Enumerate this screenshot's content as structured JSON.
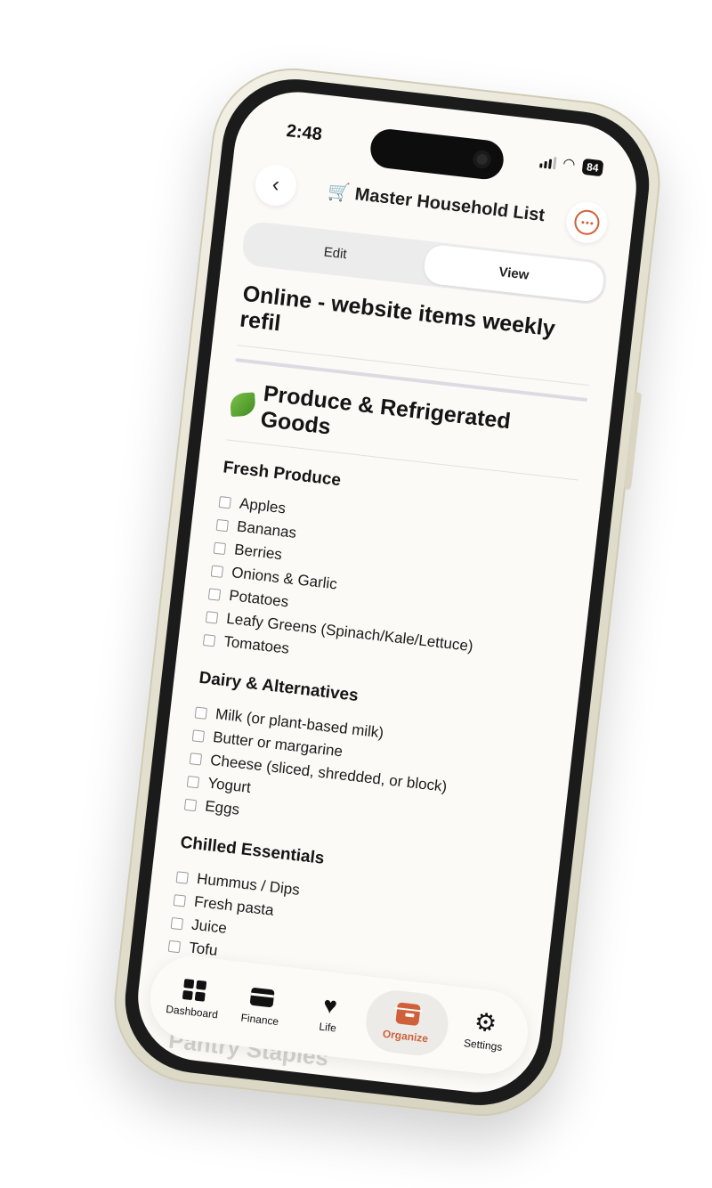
{
  "status": {
    "time": "2:48",
    "battery": "84"
  },
  "header": {
    "title": "🛒 Master Household  List"
  },
  "segments": {
    "edit": "Edit",
    "view": "View"
  },
  "document": {
    "heading": "Online - website items weekly refil",
    "section_title": "Produce & Refrigerated Goods",
    "groups": [
      {
        "title": "Fresh Produce",
        "items": [
          "Apples",
          "Bananas",
          "Berries",
          "Onions & Garlic",
          "Potatoes",
          "Leafy Greens (Spinach/Kale/Lettuce)",
          "Tomatoes"
        ]
      },
      {
        "title": "Dairy & Alternatives",
        "items": [
          "Milk (or plant-based milk)",
          "Butter or margarine",
          "Cheese (sliced, shredded, or block)",
          "Yogurt",
          "Eggs"
        ]
      },
      {
        "title": "Chilled Essentials",
        "items": [
          "Hummus / Dips",
          "Fresh pasta",
          "Juice",
          "Tofu"
        ]
      }
    ],
    "next_section_peek": "Pantry Staples"
  },
  "tabbar": {
    "dashboard": "Dashboard",
    "finance": "Finance",
    "life": "Life",
    "organize": "Organize",
    "settings": "Settings"
  },
  "colors": {
    "accent": "#d0603a",
    "background": "#fbfaf6"
  }
}
